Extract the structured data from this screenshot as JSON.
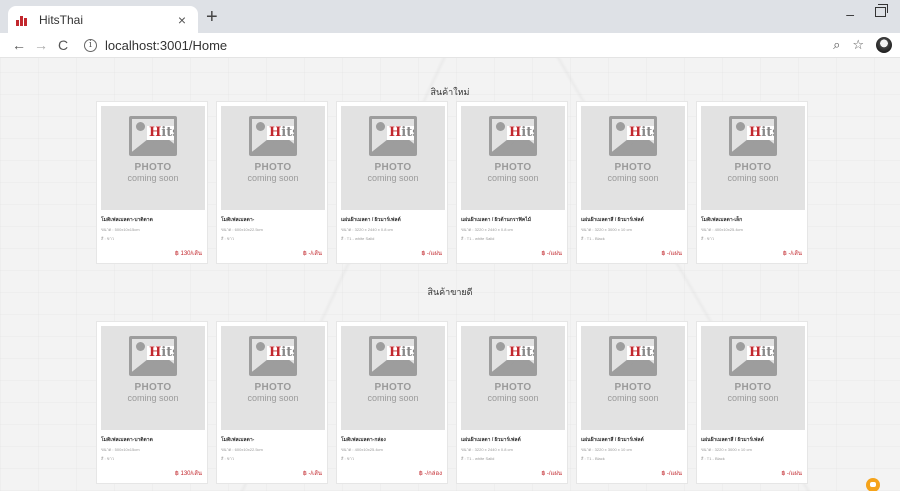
{
  "browser": {
    "tab_title": "HitsThai",
    "tab_close": "×",
    "new_tab": "+",
    "back": "←",
    "forward": "→",
    "reload": "C",
    "info": "i",
    "url": "localhost:3001/Home",
    "zoom_icon": "⌕",
    "star_icon": "☆",
    "minimize": "–"
  },
  "placeholder": {
    "logo_h": "H",
    "logo_rest": "its",
    "photo": "PHOTO",
    "coming_soon": "coming soon"
  },
  "sections": [
    {
      "title": "สินค้าใหม่",
      "products": [
        {
          "name": "โมดิเฟลเมลดา-บาดิดาด",
          "size": "ขนาด : 500x10x15cm",
          "color": "สี : ขาว",
          "price": "฿ 130/เส้น"
        },
        {
          "name": "โมดิเฟลเมลดา-",
          "size": "ขนาด : 600x10x22.5cm",
          "color": "สี : ขาว",
          "price": "฿ -/เส้น"
        },
        {
          "name": "แผ่นฝ้าเมลดา / ผิวมาร์เฟลต์",
          "size": "ขนาด : 3220 x 2440 x 0.8 cm",
          "color": "สี : T1 - white Salid",
          "price": "฿ -/แผ่น"
        },
        {
          "name": "แผ่นฝ้าเมลดา / ผิวด้านกราฟิคไม้",
          "size": "ขนาด : 3220 x 2440 x 0.8 cm",
          "color": "สี : T1 - white Salid",
          "price": "฿ -/แผ่น"
        },
        {
          "name": "แผ่นฝ้าเมลดาสี / ผิวมาร์เฟลต์",
          "size": "ขนาด : 3220 x 3000 x 10 cm",
          "color": "สี : T1 - Black",
          "price": "฿ -/แผ่น"
        },
        {
          "name": "โมดิเฟลเมลดา-เล็ก",
          "size": "ขนาด : 400x10x25.4cm",
          "color": "สี : ขาว",
          "price": "฿ -/เส้น"
        }
      ]
    },
    {
      "title": "สินค้าขายดี",
      "products": [
        {
          "name": "โมดิเฟลเมลดา-บาดิดาด",
          "size": "ขนาด : 500x10x15cm",
          "color": "สี : ขาว",
          "price": "฿ 130/เส้น"
        },
        {
          "name": "โมดิเฟลเมลดา-",
          "size": "ขนาด : 600x10x22.5cm",
          "color": "สี : ขาว",
          "price": "฿ -/เส้น"
        },
        {
          "name": "โมดิเฟลเมลดา-กล่อง",
          "size": "ขนาด : 400x10x25.4cm",
          "color": "สี : ขาว",
          "price": "฿ -/กล่อง"
        },
        {
          "name": "แผ่นฝ้าเมลดา / ผิวมาร์เฟลต์",
          "size": "ขนาด : 3220 x 2440 x 0.8 cm",
          "color": "สี : T1 - white Salid",
          "price": "฿ -/แผ่น"
        },
        {
          "name": "แผ่นฝ้าเมลดาสี / ผิวมาร์เฟลต์",
          "size": "ขนาด : 3220 x 3000 x 10 cm",
          "color": "สี : T1 - Black",
          "price": "฿ -/แผ่น"
        },
        {
          "name": "แผ่นฝ้าเมลดาสี / ผิวมาร์เฟลต์",
          "size": "ขนาด : 3220 x 3000 x 10 cm",
          "color": "สี : T1 - Black",
          "price": "฿ -/แผ่น"
        }
      ]
    }
  ],
  "colors": {
    "accent": "#c2272d",
    "chat_button": "#f5a31a"
  }
}
